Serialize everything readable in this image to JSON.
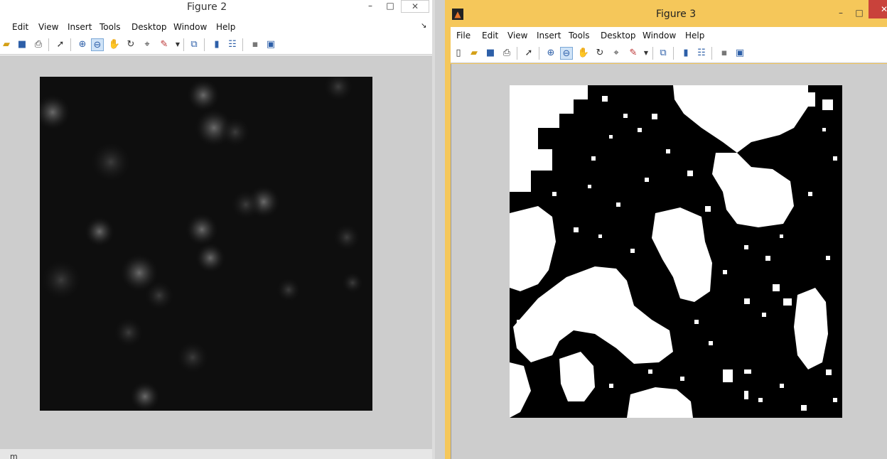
{
  "figure2": {
    "title": "Figure 2",
    "menu": [
      "Edit",
      "View",
      "Insert",
      "Tools",
      "Desktop",
      "Window",
      "Help"
    ],
    "image": "grayscale fluorescence image",
    "colors": {
      "chrome": "#ffffff",
      "client": "#cdcdcd"
    }
  },
  "figure3": {
    "title": "Figure 3",
    "menu": [
      "File",
      "Edit",
      "View",
      "Insert",
      "Tools",
      "Desktop",
      "Window",
      "Help"
    ],
    "image": "binary thresholded image",
    "colors": {
      "titlebar": "#f5c75a",
      "client": "#cdcdcd",
      "close": "#c9423b"
    }
  },
  "controls": {
    "minimize": "–",
    "maximize": "□",
    "close": "✕",
    "dock": "↘"
  },
  "bottom_text": "m",
  "icons": [
    "open-icon",
    "save-icon",
    "print-icon",
    "pointer-icon",
    "zoom-in-icon",
    "zoom-out-icon",
    "pan-icon",
    "rotate-icon",
    "data-cursor-icon",
    "brush-icon",
    "link-icon",
    "colorbar-icon",
    "legend-icon",
    "hide-tools-icon",
    "show-tools-icon",
    "new-figure-icon"
  ]
}
